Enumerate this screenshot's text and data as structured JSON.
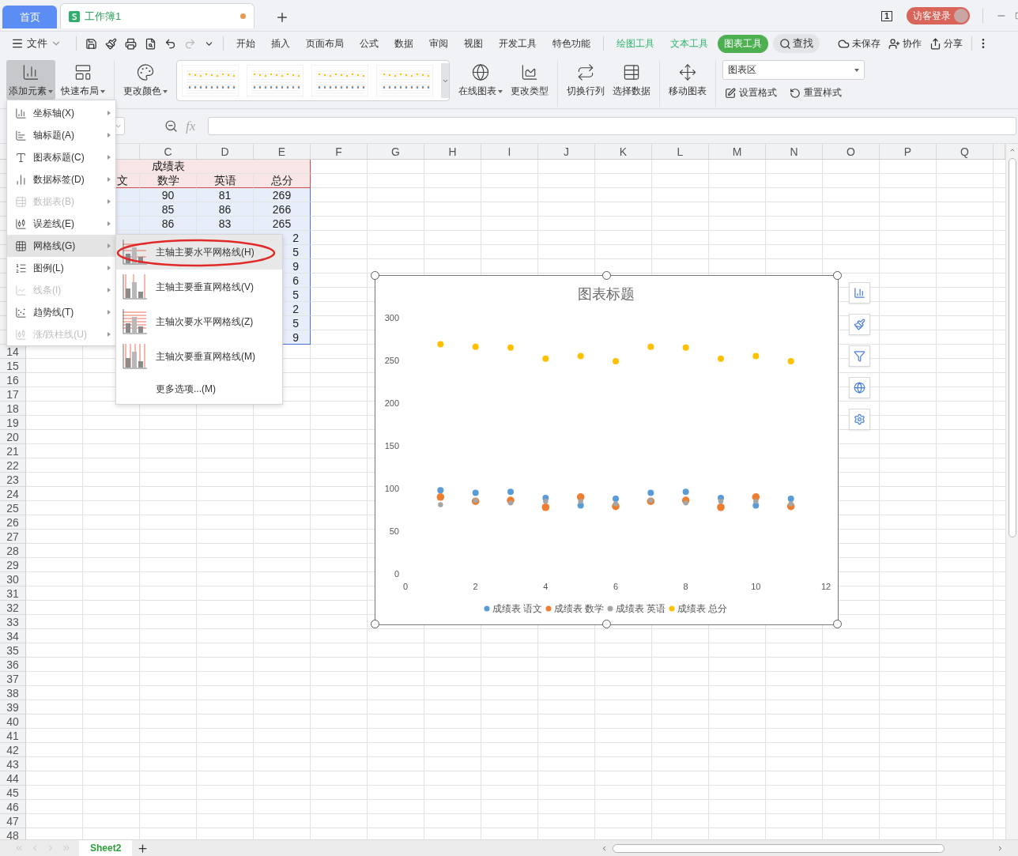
{
  "tabs": [
    {
      "label": "首页",
      "kind": "home",
      "selected": false
    },
    {
      "label": "工作簿1",
      "kind": "workbook",
      "selected": true,
      "unsaved": true
    }
  ],
  "title_bar": {
    "window_count": "1",
    "login": "访客登录"
  },
  "menu_bar": {
    "file": "文件",
    "tabs": [
      {
        "label": "开始",
        "kind": "main",
        "selected": false
      },
      {
        "label": "插入",
        "kind": "main",
        "selected": false
      },
      {
        "label": "页面布局",
        "kind": "main",
        "selected": false
      },
      {
        "label": "公式",
        "kind": "main",
        "selected": false
      },
      {
        "label": "数据",
        "kind": "main",
        "selected": false
      },
      {
        "label": "审阅",
        "kind": "main",
        "selected": false
      },
      {
        "label": "视图",
        "kind": "main",
        "selected": false
      },
      {
        "label": "开发工具",
        "kind": "main",
        "selected": false
      },
      {
        "label": "特色功能",
        "kind": "main",
        "selected": false
      },
      {
        "label": "绘图工具",
        "kind": "context",
        "selected": false
      },
      {
        "label": "文本工具",
        "kind": "context",
        "selected": false
      },
      {
        "label": "图表工具",
        "kind": "context",
        "selected": true
      }
    ],
    "search": "查找",
    "actions": [
      {
        "label": "未保存",
        "kind": "cloud"
      },
      {
        "label": "协作",
        "kind": "collab"
      },
      {
        "label": "分享",
        "kind": "share"
      }
    ]
  },
  "ribbon": {
    "groups": [
      {
        "items": [
          {
            "label": "添加元素",
            "kind": "add",
            "dropdown": true,
            "active": true
          },
          {
            "label": "快速布局",
            "kind": "layout",
            "dropdown": true,
            "active": false
          }
        ]
      },
      {
        "items": [
          {
            "label": "更改颜色",
            "kind": "color",
            "dropdown": true,
            "active": false
          },
          {
            "kind": "gallery"
          },
          {
            "label": "在线图表",
            "kind": "online",
            "dropdown": true,
            "active": false
          },
          {
            "label": "更改类型",
            "kind": "type",
            "dropdown": false,
            "active": false
          }
        ]
      },
      {
        "items": [
          {
            "label": "切换行列",
            "kind": "switch",
            "dropdown": false,
            "active": false
          },
          {
            "label": "选择数据",
            "kind": "select",
            "dropdown": false,
            "active": false
          }
        ]
      },
      {
        "items": [
          {
            "label": "移动图表",
            "kind": "move",
            "dropdown": false,
            "active": false
          }
        ]
      }
    ],
    "element_select": "图表区",
    "format_buttons": [
      {
        "label": "设置格式",
        "kind": "format"
      },
      {
        "label": "重置样式",
        "kind": "reset"
      }
    ]
  },
  "formula_bar": {
    "fx": "fx"
  },
  "sheet": {
    "columns": [
      "C",
      "D",
      "E",
      "F",
      "G",
      "H",
      "I",
      "J",
      "K",
      "L",
      "M",
      "N",
      "O",
      "P",
      "Q"
    ],
    "row_numbers": [
      "14",
      "15",
      "16",
      "17",
      "18",
      "19",
      "20",
      "21",
      "22",
      "23",
      "24",
      "25",
      "26",
      "27",
      "28",
      "29",
      "30",
      "31",
      "32",
      "33",
      "34",
      "35",
      "36",
      "37",
      "38",
      "39",
      "40",
      "41",
      "42",
      "43",
      "44",
      "45",
      "46",
      "47",
      "48"
    ],
    "table": {
      "title": "成绩表",
      "headers": [
        "文",
        "数学",
        "英语",
        "总分"
      ],
      "rows": [
        [
          "90",
          "81",
          "269"
        ],
        [
          "85",
          "86",
          "266"
        ],
        [
          "86",
          "83",
          "265"
        ]
      ],
      "cut_totals": [
        "2",
        "5",
        "9",
        "6",
        "5",
        "2",
        "5",
        "9"
      ]
    }
  },
  "add_element_menu": {
    "items": [
      {
        "label": "坐标轴(X)",
        "kind": "axis",
        "disabled": false,
        "selected": false
      },
      {
        "label": "轴标题(A)",
        "kind": "axis_title",
        "disabled": false,
        "selected": false
      },
      {
        "label": "图表标题(C)",
        "kind": "chart_title",
        "disabled": false,
        "selected": false
      },
      {
        "label": "数据标签(D)",
        "kind": "data_labels",
        "disabled": false,
        "selected": false
      },
      {
        "label": "数据表(B)",
        "kind": "data_table",
        "disabled": true,
        "selected": false
      },
      {
        "label": "误差线(E)",
        "kind": "error_bars",
        "disabled": false,
        "selected": false
      },
      {
        "label": "网格线(G)",
        "kind": "gridlines",
        "disabled": false,
        "selected": true
      },
      {
        "label": "图例(L)",
        "kind": "legend",
        "disabled": false,
        "selected": false
      },
      {
        "label": "线条(I)",
        "kind": "lines",
        "disabled": true,
        "selected": false
      },
      {
        "label": "趋势线(T)",
        "kind": "trendline",
        "disabled": false,
        "selected": false
      },
      {
        "label": "涨/跌柱线(U)",
        "kind": "updown",
        "disabled": true,
        "selected": false
      }
    ],
    "submenu": [
      {
        "label": "主轴主要水平网格线(H)",
        "kind": "h_major",
        "selected": true,
        "circled": true
      },
      {
        "label": "主轴主要垂直网格线(V)",
        "kind": "v_major",
        "selected": false,
        "circled": false
      },
      {
        "label": "主轴次要水平网格线(Z)",
        "kind": "h_minor",
        "selected": false,
        "circled": false
      },
      {
        "label": "主轴次要垂直网格线(M)",
        "kind": "v_minor",
        "selected": false,
        "circled": false
      },
      {
        "label": "更多选项...(M)",
        "kind": "more",
        "selected": false,
        "circled": false
      }
    ]
  },
  "chart": {
    "side_buttons": [
      {
        "kind": "elements"
      },
      {
        "kind": "style"
      },
      {
        "kind": "filter"
      },
      {
        "kind": "online"
      },
      {
        "kind": "settings"
      }
    ],
    "chart_data": {
      "type": "scatter",
      "title": "图表标题",
      "x": [
        1,
        2,
        3,
        4,
        5,
        6,
        7,
        8,
        9,
        10,
        11
      ],
      "xlim": [
        0,
        12
      ],
      "ylim": [
        0,
        300
      ],
      "legend": true,
      "xticks": [
        0,
        2,
        4,
        6,
        8,
        10,
        12
      ],
      "yticks": [
        0,
        50,
        100,
        150,
        200,
        250,
        300
      ],
      "series": [
        {
          "name": "成绩表 语文",
          "color": "#5b9bd5",
          "values": [
            98,
            95,
            96,
            89,
            80,
            88,
            95,
            96,
            89,
            80,
            88
          ]
        },
        {
          "name": "成绩表 数学",
          "color": "#ed7d31",
          "values": [
            90,
            85,
            86,
            78,
            90,
            79,
            85,
            86,
            78,
            90,
            79
          ]
        },
        {
          "name": "成绩表 英语",
          "color": "#a5a5a5",
          "values": [
            81,
            86,
            83,
            85,
            85,
            82,
            86,
            83,
            85,
            85,
            82
          ]
        },
        {
          "name": "成绩表 总分",
          "color": "#ffc000",
          "values": [
            269,
            266,
            265,
            252,
            255,
            249,
            266,
            265,
            252,
            255,
            249
          ]
        }
      ]
    }
  },
  "sheet_tabs": [
    {
      "label": "Sheet2",
      "selected": true
    }
  ]
}
